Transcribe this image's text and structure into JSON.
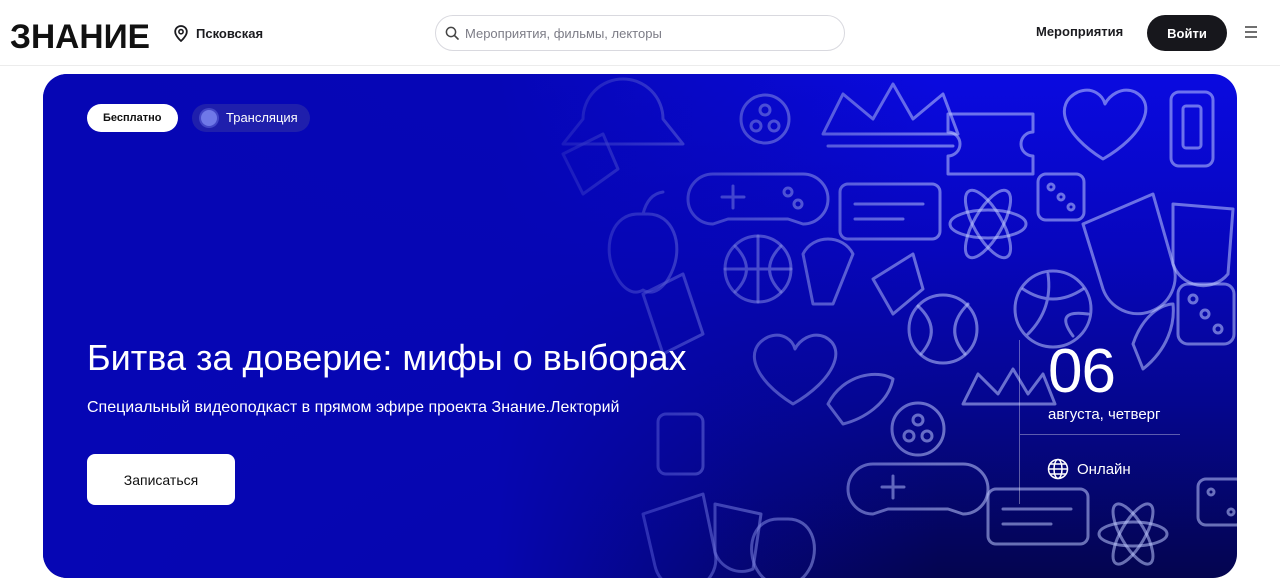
{
  "header": {
    "logo_text": "ЗНАНИЕ",
    "region": "Псковская",
    "search_placeholder": "Мероприятия, фильмы, лекторы",
    "nav_events": "Мероприятия",
    "login_label": "Войти"
  },
  "hero": {
    "badge_free": "Бесплатно",
    "badge_stream": "Трансляция",
    "title": "Битва за доверие: мифы о выборах",
    "subtitle": "Специальный видеоподкаст в прямом эфире проекта Знание.Лекторий",
    "signup_label": "Записаться",
    "date_day": "06",
    "date_weekday": "августа, четверг",
    "format": "Онлайн"
  },
  "colors": {
    "hero_gradient_top": "#0a0ae0",
    "hero_gradient_bottom": "#04054f",
    "login_button": "#17171c"
  },
  "icons": [
    "location-pin-icon",
    "search-icon",
    "burger-menu-icon",
    "globe-icon"
  ]
}
